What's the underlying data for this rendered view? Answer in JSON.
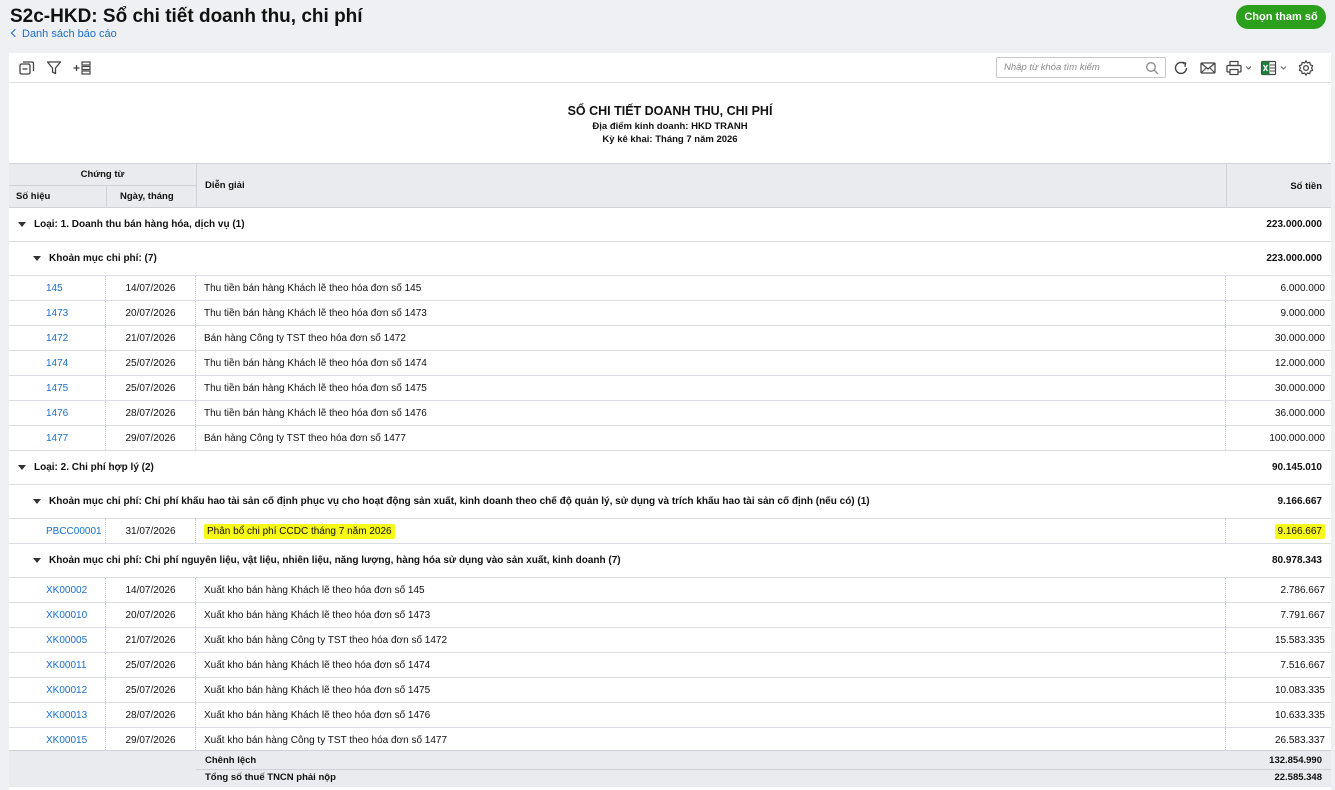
{
  "header": {
    "title": "S2c-HKD: Sổ chi tiết doanh thu, chi phí",
    "back_link": "Danh sách báo cáo",
    "params_button": "Chọn tham số"
  },
  "toolbar": {
    "search_placeholder": "Nhập từ khóa tìm kiếm"
  },
  "report": {
    "title": "SỔ CHI TIẾT DOANH THU, CHI PHÍ",
    "location": "Địa điểm kinh doanh: HKD TRANH",
    "period": "Kỳ kê khai: Tháng 7 năm 2026"
  },
  "columns": {
    "voucher_group": "Chứng từ",
    "voucher_no": "Số hiệu",
    "date": "Ngày, tháng",
    "description": "Diễn giải",
    "amount": "Số tiền"
  },
  "rows": [
    {
      "type": "group1",
      "text": "Loại: 1. Doanh thu bán hàng hóa, dịch vụ (1)",
      "amount": "223.000.000"
    },
    {
      "type": "group2",
      "text": "Khoản mục chi phí:  (7)",
      "amount": "223.000.000"
    },
    {
      "type": "data",
      "no": "145",
      "date": "14/07/2026",
      "desc": "Thu tiền bán hàng Khách lẽ theo hóa đơn số 145",
      "amount": "6.000.000"
    },
    {
      "type": "data",
      "no": "1473",
      "date": "20/07/2026",
      "desc": "Thu tiền bán hàng Khách lẽ theo hóa đơn số 1473",
      "amount": "9.000.000"
    },
    {
      "type": "data",
      "no": "1472",
      "date": "21/07/2026",
      "desc": "Bán hàng Công ty TST theo hóa đơn số 1472",
      "amount": "30.000.000"
    },
    {
      "type": "data",
      "no": "1474",
      "date": "25/07/2026",
      "desc": "Thu tiền bán hàng Khách lẽ theo hóa đơn số 1474",
      "amount": "12.000.000"
    },
    {
      "type": "data",
      "no": "1475",
      "date": "25/07/2026",
      "desc": "Thu tiền bán hàng Khách lẽ theo hóa đơn số 1475",
      "amount": "30.000.000"
    },
    {
      "type": "data",
      "no": "1476",
      "date": "28/07/2026",
      "desc": "Thu tiền bán hàng Khách lẽ theo hóa đơn số 1476",
      "amount": "36.000.000"
    },
    {
      "type": "data",
      "no": "1477",
      "date": "29/07/2026",
      "desc": "Bán hàng Công ty TST theo hóa đơn số 1477",
      "amount": "100.000.000"
    },
    {
      "type": "group1",
      "text": "Loại: 2. Chi phí hợp lý (2)",
      "amount": "90.145.010"
    },
    {
      "type": "group2",
      "text": "Khoản mục chi phí: Chi phí khấu hao tài sản cố định phục vụ cho hoạt động sản xuất, kinh doanh theo chế độ quản lý, sử dụng và trích khấu hao tài sản cố định (nếu có) (1)",
      "amount": "9.166.667"
    },
    {
      "type": "data",
      "no": "PBCC00001",
      "date": "31/07/2026",
      "desc": "Phân bổ chi phí CCDC tháng 7 năm 2026",
      "amount": "9.166.667",
      "highlight": true
    },
    {
      "type": "group2",
      "text": "Khoản mục chi phí: Chi phí nguyên liệu, vật liệu, nhiên liệu, năng lượng, hàng hóa sử dụng vào sản xuất, kinh doanh (7)",
      "amount": "80.978.343"
    },
    {
      "type": "data",
      "no": "XK00002",
      "date": "14/07/2026",
      "desc": "Xuất kho bán hàng Khách lẽ theo hóa đơn số 145",
      "amount": "2.786.667"
    },
    {
      "type": "data",
      "no": "XK00010",
      "date": "20/07/2026",
      "desc": "Xuất kho bán hàng Khách lẽ theo hóa đơn số 1473",
      "amount": "7.791.667"
    },
    {
      "type": "data",
      "no": "XK00005",
      "date": "21/07/2026",
      "desc": "Xuất kho bán hàng Công ty TST theo hóa đơn số 1472",
      "amount": "15.583.335"
    },
    {
      "type": "data",
      "no": "XK00011",
      "date": "25/07/2026",
      "desc": "Xuất kho bán hàng Khách lẽ theo hóa đơn số 1474",
      "amount": "7.516.667"
    },
    {
      "type": "data",
      "no": "XK00012",
      "date": "25/07/2026",
      "desc": "Xuất kho bán hàng Khách lẽ theo hóa đơn số 1475",
      "amount": "10.083.335"
    },
    {
      "type": "data",
      "no": "XK00013",
      "date": "28/07/2026",
      "desc": "Xuất kho bán hàng Khách lẽ theo hóa đơn số 1476",
      "amount": "10.633.335"
    },
    {
      "type": "data",
      "no": "XK00015",
      "date": "29/07/2026",
      "desc": "Xuất kho bán hàng Công ty TST theo hóa đơn số 1477",
      "amount": "26.583.337"
    }
  ],
  "footer": {
    "difference_label": "Chênh lệch",
    "difference_value": "132.854.990",
    "tax_label": "Tổng số thuế TNCN phải nộp",
    "tax_value": "22.585.348"
  }
}
